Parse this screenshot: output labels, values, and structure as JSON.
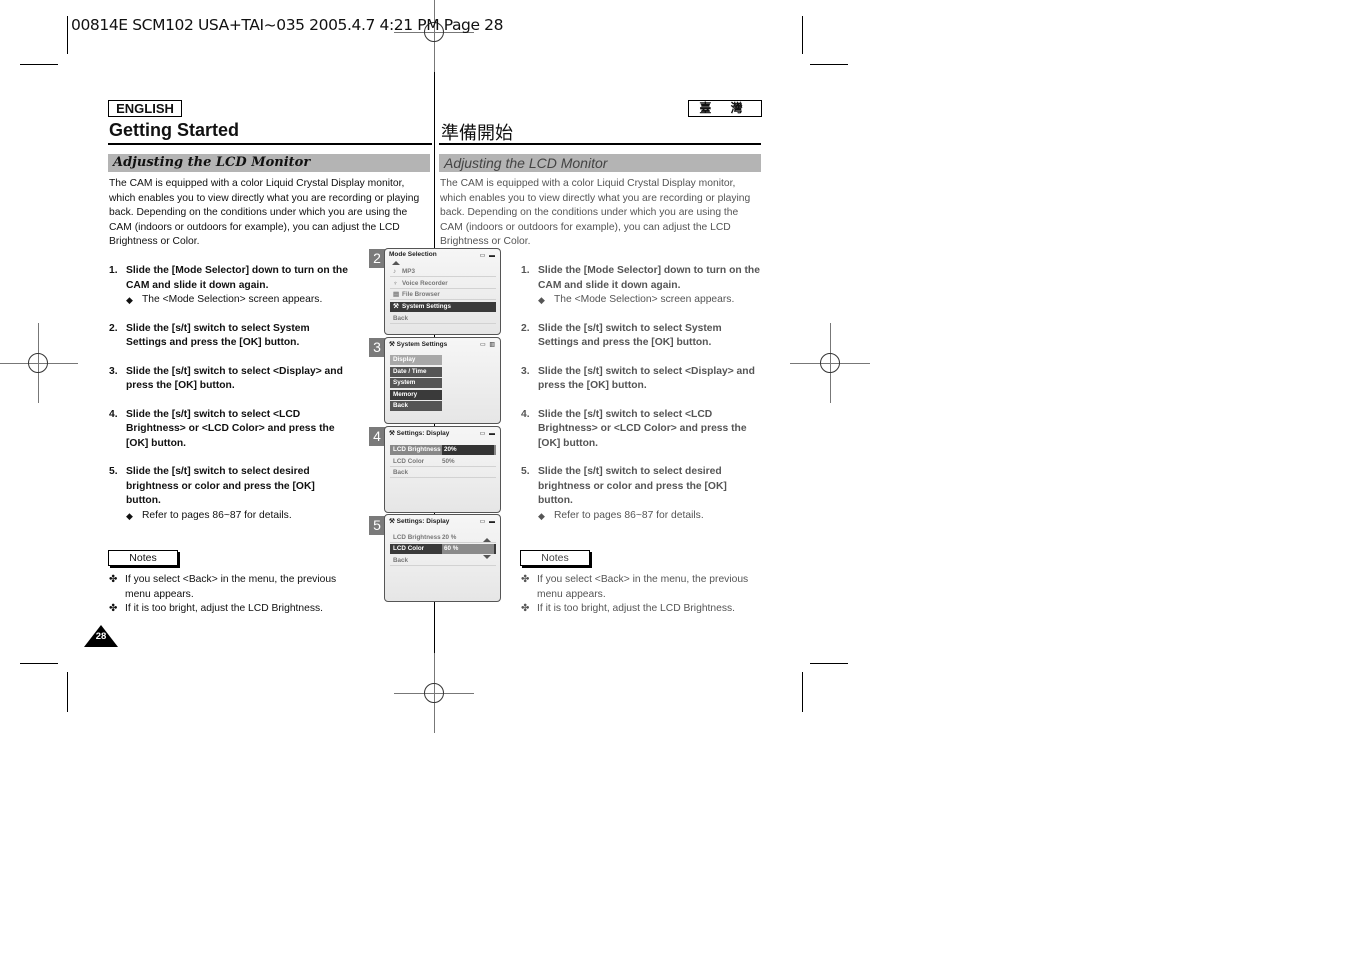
{
  "slug": "00814E SCM102 USA+TAI~035 2005.4.7 4:21 PM Page 28",
  "left_page": {
    "language_tag": "ENGLISH",
    "title": "Getting Started",
    "section": "Adjusting the LCD Monitor",
    "intro": "The CAM is equipped with a color Liquid Crystal Display monitor, which enables you to view directly what you are recording or playing back. Depending on the conditions under which you are using the CAM (indoors or outdoors for example), you can adjust the LCD Brightness or Color.",
    "steps": [
      {
        "num": "1.",
        "text": "Slide the [Mode Selector] down to turn on the CAM and slide it down again.",
        "sub": "The <Mode Selection> screen appears."
      },
      {
        "num": "2.",
        "text": "Slide the [s/t] switch to select System Settings and press the [OK] button.",
        "sub": ""
      },
      {
        "num": "3.",
        "text": "Slide the [s/t] switch to select <Display> and press the [OK] button.",
        "sub": ""
      },
      {
        "num": "4.",
        "text": "Slide the [s/t] switch to select <LCD Brightness> or <LCD Color> and press the [OK] button.",
        "sub": ""
      },
      {
        "num": "5.",
        "text": "Slide the [s/t] switch to select desired brightness or color and press the [OK] button.",
        "sub": "Refer to pages 86~87 for details."
      }
    ],
    "notes_label": "Notes",
    "notes": [
      "If you select <Back> in the menu, the previous menu appears.",
      "If it is too bright, adjust the LCD Brightness."
    ],
    "page_number": "28"
  },
  "right_page": {
    "language_tag": "臺 灣",
    "title": "準備開始",
    "section": "Adjusting the LCD Monitor",
    "intro": "The CAM is equipped with a color Liquid Crystal Display monitor, which enables you to view directly what you are recording or playing back. Depending on the conditions under which you are using the CAM (indoors or outdoors for example), you can adjust the LCD Brightness or Color.",
    "steps": [
      {
        "num": "1.",
        "text": "Slide the [Mode Selector] down to turn on the CAM and slide it down again.",
        "sub": "The <Mode Selection> screen appears."
      },
      {
        "num": "2.",
        "text": "Slide the [s/t] switch to select System Settings and press the [OK] button.",
        "sub": ""
      },
      {
        "num": "3.",
        "text": "Slide the [s/t] switch to select <Display> and press the [OK] button.",
        "sub": ""
      },
      {
        "num": "4.",
        "text": "Slide the [s/t] switch to select <LCD Brightness> or <LCD Color> and press the [OK] button.",
        "sub": ""
      },
      {
        "num": "5.",
        "text": "Slide the [s/t] switch to select desired brightness or color and press the [OK] button.",
        "sub": "Refer to pages 86~87 for details."
      }
    ],
    "notes_label": "Notes",
    "notes": [
      "If you select <Back> in the menu, the previous menu appears.",
      "If it is too bright, adjust the LCD Brightness."
    ]
  },
  "screens": {
    "s2": {
      "num": "2",
      "title": "Mode Selection",
      "items": [
        {
          "icon": "♪",
          "label": "MP3"
        },
        {
          "icon": "🎙",
          "label": "Voice Recorder"
        },
        {
          "icon": "▤",
          "label": "File Browser"
        },
        {
          "icon": "⚒",
          "label": "System Settings"
        },
        {
          "icon": "",
          "label": "Back"
        }
      ],
      "selected": "System Settings"
    },
    "s3": {
      "num": "3",
      "title": "System Settings",
      "items": [
        "Display",
        "Date / Time",
        "System",
        "Memory",
        "Back"
      ],
      "selected": "Display"
    },
    "s4": {
      "num": "4",
      "title": "Settings: Display",
      "items": [
        {
          "label": "LCD Brightness",
          "value": "20%"
        },
        {
          "label": "LCD Color",
          "value": "50%"
        },
        {
          "label": "Back",
          "value": ""
        }
      ],
      "selected": "LCD Brightness"
    },
    "s5": {
      "num": "5",
      "title": "Settings: Display",
      "items": [
        {
          "label": "LCD Brightness",
          "value": "20 %"
        },
        {
          "label": "LCD Color",
          "value": "60 %"
        },
        {
          "label": "Back",
          "value": ""
        }
      ],
      "selected": "LCD Color"
    }
  },
  "colors": {
    "section_bar": "#b4b4b4",
    "screen_selected": "#3a3a3a",
    "step_badge": "#7a7a7a"
  }
}
